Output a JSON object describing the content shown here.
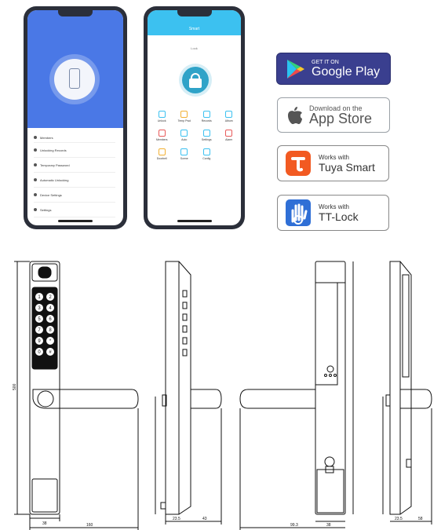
{
  "phone1": {
    "menu_items": [
      "Members",
      "Unlocking Records",
      "Temporary Password",
      "Automatic Unlocking",
      "Device Settings",
      "Settings"
    ]
  },
  "phone2": {
    "header_title": "Smart",
    "device_name": "Lock",
    "grid_labels": [
      "Unlock",
      "Temp Pwd",
      "Records",
      "Album",
      "Members",
      "Auto",
      "Settings",
      "Alarm",
      "Doorbell",
      "Scene",
      "Config"
    ]
  },
  "badges": {
    "google_play": {
      "small": "GET IT ON",
      "big": "Google Play",
      "bg": "#3a3f8f"
    },
    "app_store": {
      "small": "Download on the",
      "big": "App Store"
    },
    "tuya": {
      "small": "Works with",
      "big": "Tuya Smart",
      "icon_color": "#f25a22"
    },
    "ttlock": {
      "small": "Works with",
      "big": "TT-Lock",
      "icon_color": "#2f6fd6"
    }
  },
  "keypad": {
    "keys": [
      "1",
      "2",
      "3",
      "4",
      "5",
      "6",
      "7",
      "8",
      "9",
      "*",
      "0",
      "#"
    ]
  },
  "dimension_labels": {
    "front_width": "38",
    "front_handle": "160",
    "side_total": "500",
    "side_depth1": "23.5",
    "side_depth2": "43",
    "rear_width": "38",
    "rear_lower": "99.3",
    "right_depth": "23.5",
    "right_depth2": "58"
  }
}
